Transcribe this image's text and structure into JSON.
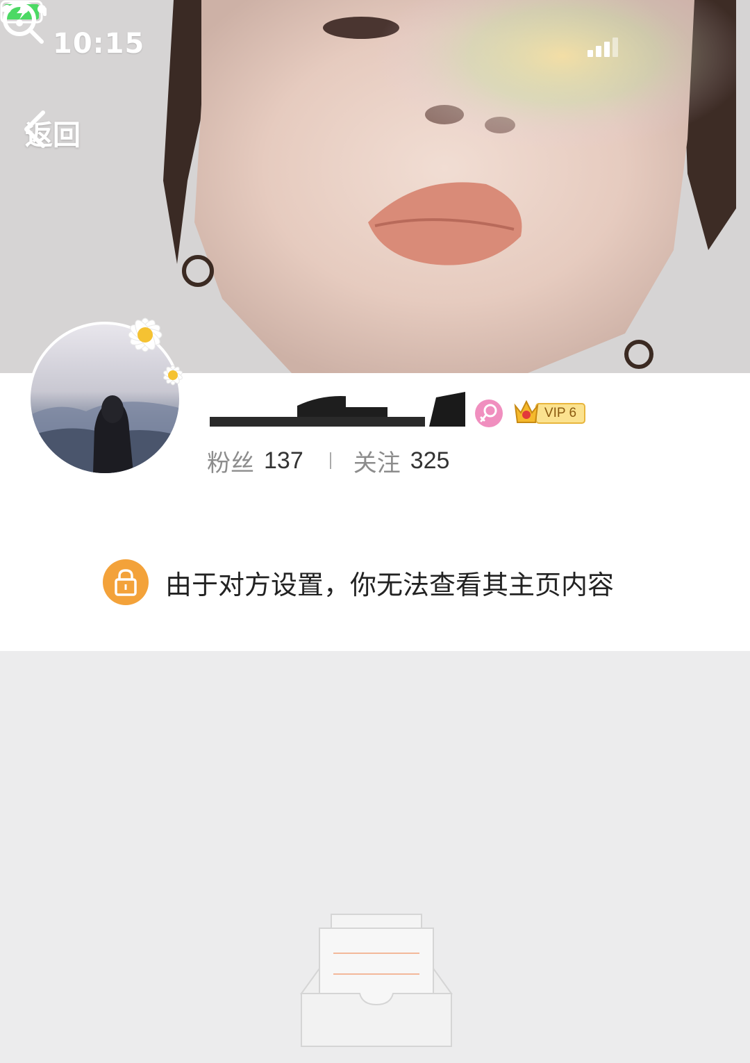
{
  "status_bar": {
    "time": "10:15",
    "icons": [
      "cellular-signal-icon",
      "wifi-icon",
      "battery-charging-icon"
    ]
  },
  "nav": {
    "back_label": "返回",
    "icons": [
      "chevron-left-icon",
      "search-icon",
      "more-icon"
    ]
  },
  "profile": {
    "username": "",
    "gender_icon": "female-icon",
    "vip_label": "VIP 6",
    "stats": {
      "fans_label": "粉丝",
      "fans_count": "137",
      "following_label": "关注",
      "following_count": "325"
    }
  },
  "privacy_notice": {
    "icon": "lock-icon",
    "text": "由于对方设置，你无法查看其主页内容"
  },
  "empty_state": {
    "icon": "empty-box-icon"
  },
  "colors": {
    "accent_orange": "#f3a23a",
    "gender_pink": "#f08fbf",
    "vip_gold": "#f5c64a",
    "page_gray": "#ececed"
  }
}
